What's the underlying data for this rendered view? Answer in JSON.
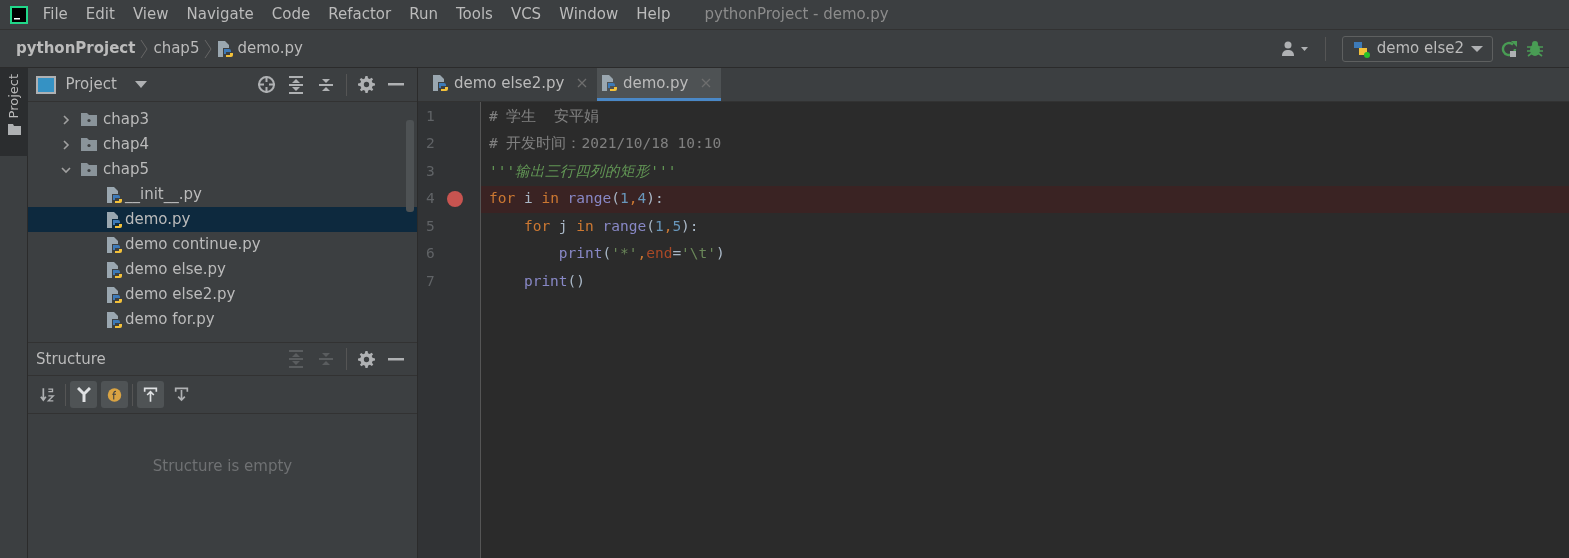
{
  "menu_bar": {
    "items": [
      "File",
      "Edit",
      "View",
      "Navigate",
      "Code",
      "Refactor",
      "Run",
      "Tools",
      "VCS",
      "Window",
      "Help"
    ],
    "window_title": "pythonProject - demo.py"
  },
  "breadcrumb": [
    "pythonProject",
    "chap5",
    "demo.py"
  ],
  "run_config": {
    "label": "demo else2"
  },
  "side_strip": {
    "label": "Project"
  },
  "project_panel": {
    "title": "Project",
    "tree": [
      {
        "label": "chap3",
        "kind": "folder",
        "expanded": false,
        "selected": false
      },
      {
        "label": "chap4",
        "kind": "folder",
        "expanded": false,
        "selected": false
      },
      {
        "label": "chap5",
        "kind": "folder",
        "expanded": true,
        "selected": false,
        "children": [
          {
            "label": "__init__.py",
            "kind": "file",
            "selected": false
          },
          {
            "label": "demo.py",
            "kind": "file",
            "selected": true
          },
          {
            "label": "demo continue.py",
            "kind": "file",
            "selected": false
          },
          {
            "label": "demo else.py",
            "kind": "file",
            "selected": false
          },
          {
            "label": "demo else2.py",
            "kind": "file",
            "selected": false
          },
          {
            "label": "demo for.py",
            "kind": "file",
            "selected": false
          }
        ]
      }
    ]
  },
  "structure_panel": {
    "title": "Structure",
    "empty_text": "Structure is empty"
  },
  "editor": {
    "tabs": [
      {
        "label": "demo else2.py",
        "selected": false
      },
      {
        "label": "demo.py",
        "selected": true
      }
    ],
    "lines": [
      {
        "number": "1",
        "breakpoint": false,
        "tokens": [
          {
            "t": "# 学生  安平娟",
            "kind": "comment"
          }
        ]
      },
      {
        "number": "2",
        "breakpoint": false,
        "tokens": [
          {
            "t": "# 开发时间：2021/10/18 10:10",
            "kind": "comment"
          }
        ]
      },
      {
        "number": "3",
        "breakpoint": false,
        "tokens": [
          {
            "t": "'''输出三行四列的矩形'''",
            "kind": "docstring"
          }
        ]
      },
      {
        "number": "4",
        "breakpoint": true,
        "tokens": [
          {
            "t": "for",
            "kind": "keyword"
          },
          {
            "t": " i ",
            "kind": "plain"
          },
          {
            "t": "in ",
            "kind": "keyword"
          },
          {
            "t": "range",
            "kind": "builtin"
          },
          {
            "t": "(",
            "kind": "plain"
          },
          {
            "t": "1",
            "kind": "number"
          },
          {
            "t": ",",
            "kind": "punct"
          },
          {
            "t": "4",
            "kind": "number"
          },
          {
            "t": "):",
            "kind": "plain"
          }
        ]
      },
      {
        "number": "5",
        "breakpoint": false,
        "tokens": [
          {
            "t": "    for",
            "kind": "keyword"
          },
          {
            "t": " j ",
            "kind": "plain"
          },
          {
            "t": "in ",
            "kind": "keyword"
          },
          {
            "t": "range",
            "kind": "builtin"
          },
          {
            "t": "(",
            "kind": "plain"
          },
          {
            "t": "1",
            "kind": "number"
          },
          {
            "t": ",",
            "kind": "punct"
          },
          {
            "t": "5",
            "kind": "number"
          },
          {
            "t": "):",
            "kind": "plain"
          }
        ]
      },
      {
        "number": "6",
        "breakpoint": false,
        "tokens": [
          {
            "t": "        print",
            "kind": "builtin"
          },
          {
            "t": "(",
            "kind": "plain"
          },
          {
            "t": "'*'",
            "kind": "string"
          },
          {
            "t": ",",
            "kind": "punct"
          },
          {
            "t": "end",
            "kind": "param"
          },
          {
            "t": "=",
            "kind": "plain"
          },
          {
            "t": "'\\t'",
            "kind": "string"
          },
          {
            "t": ")",
            "kind": "plain"
          }
        ]
      },
      {
        "number": "7",
        "breakpoint": false,
        "tokens": [
          {
            "t": "    print",
            "kind": "builtin"
          },
          {
            "t": "()",
            "kind": "plain"
          }
        ]
      }
    ]
  }
}
